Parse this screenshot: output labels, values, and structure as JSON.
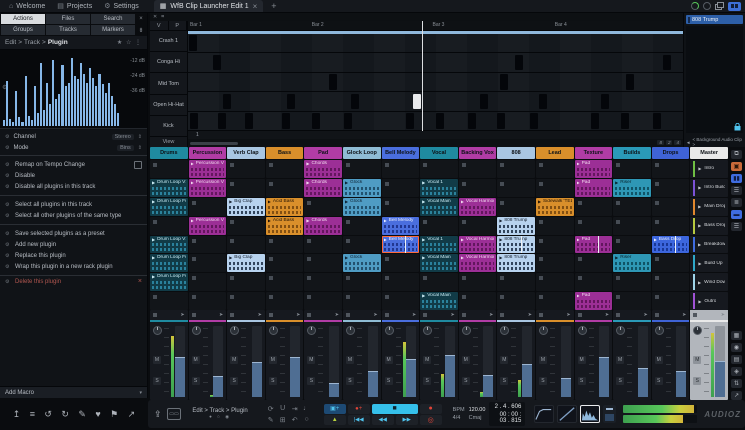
{
  "top_bar": {
    "menu": [
      {
        "name": "welcome",
        "icon_name": "home-icon",
        "icon": "⌂",
        "label": "Welcome"
      },
      {
        "name": "projects",
        "icon_name": "folder-icon",
        "icon": "▤",
        "label": "Projects"
      },
      {
        "name": "settings",
        "icon_name": "gear-icon",
        "icon": "⚙",
        "label": "Settings"
      }
    ],
    "tab": {
      "icon": "▦",
      "title": "WfB Clip Launcher Edit 1",
      "close": "×"
    },
    "new_tab": "+"
  },
  "left_panel": {
    "tabs": [
      {
        "label": "Actions",
        "active": true
      },
      {
        "label": "Files",
        "active": false
      },
      {
        "label": "Search",
        "active": false
      },
      {
        "label": "Groups",
        "active": false
      },
      {
        "label": "Tracks",
        "active": false
      },
      {
        "label": "Markers",
        "active": false
      }
    ],
    "tab_side_icons": [
      {
        "name": "close-panel-icon",
        "glyph": "×"
      },
      {
        "name": "pin-panel-icon",
        "glyph": "⇟"
      }
    ],
    "breadcrumb": {
      "parts": [
        "Edit",
        "Track",
        "Plugin"
      ],
      "sep": ">",
      "stars": "★ ☆ ⋮"
    },
    "spectrum": {
      "db_labels": [
        "-12 dB",
        "-24 dB",
        "-36 dB"
      ],
      "bars": [
        8,
        62,
        10,
        6,
        48,
        12,
        5,
        70,
        14,
        8,
        55,
        18,
        88,
        22,
        60,
        30,
        92,
        38,
        45,
        85,
        55,
        60,
        95,
        70,
        65,
        88,
        72,
        60,
        80,
        66,
        55,
        72,
        58,
        46,
        60,
        42,
        30,
        18
      ]
    },
    "properties": [
      {
        "label": "Channel",
        "value": "Stereo"
      },
      {
        "label": "Mode",
        "value": "Bins"
      }
    ],
    "action_groups": [
      [
        {
          "label": "Remap on Tempo Change",
          "checkbox": true
        },
        {
          "label": "Disable"
        },
        {
          "label": "Disable all plugins in this track"
        }
      ],
      [
        {
          "label": "Select all plugins in this track"
        },
        {
          "label": "Select all other plugins of the same type"
        }
      ],
      [
        {
          "label": "Save selected plugins as a preset"
        },
        {
          "label": "Add new plugin"
        },
        {
          "label": "Replace this plugin"
        },
        {
          "label": "Wrap this plugin in a new rack plugin"
        }
      ]
    ],
    "delete_action": "Delete this plugin",
    "add_macro": "Add Macro",
    "toolbar_icons": [
      {
        "name": "import-icon",
        "glyph": "↥"
      },
      {
        "name": "menu-icon",
        "glyph": "≡"
      },
      {
        "name": "undo-icon",
        "glyph": "↺"
      },
      {
        "name": "redo-icon",
        "glyph": "↻"
      },
      {
        "name": "tools-icon",
        "glyph": "✎"
      },
      {
        "name": "favorites-icon",
        "glyph": "♥"
      },
      {
        "name": "flag-icon",
        "glyph": "⚑"
      },
      {
        "name": "export-icon",
        "glyph": "↗"
      }
    ]
  },
  "editor": {
    "top_icons": [
      {
        "name": "close-editor-icon",
        "glyph": "✕"
      },
      {
        "name": "grid-mode-icon",
        "glyph": "⌗"
      }
    ],
    "columns": [
      "V",
      "P"
    ],
    "rows": [
      {
        "label": "Crash 1",
        "notes": [
          0.002
        ]
      },
      {
        "label": "Conga Hi",
        "notes": [
          0.05,
          0.66,
          0.96
        ]
      },
      {
        "label": "Mid Tom",
        "notes": [
          0.285,
          0.63,
          0.885
        ]
      },
      {
        "label": "Open Hi-Hat",
        "notes": [
          0.07,
          0.2,
          0.33,
          0.455,
          0.59,
          0.71,
          0.835
        ],
        "white_note": 0.455
      },
      {
        "label": "Kick",
        "notes": [
          0.004,
          0.06,
          0.115,
          0.19,
          0.25,
          0.315,
          0.44,
          0.5,
          0.565,
          0.625,
          0.69,
          0.815,
          0.875,
          0.94
        ]
      }
    ],
    "view_label": "View",
    "footer_number": "1",
    "bars": [
      {
        "label": "Bar 1",
        "pos": 0.004
      },
      {
        "label": "Bar 2",
        "pos": 0.25
      },
      {
        "label": "Bar 3",
        "pos": 0.494
      },
      {
        "label": "Bar 4",
        "pos": 0.741
      }
    ],
    "playhead": 0.472,
    "pattern_controls": [
      "8",
      "2",
      "4"
    ]
  },
  "right_panel": {
    "clip_name": "808 Trump",
    "footer_arrow": "◄",
    "footer": "< Background Audio Clip >"
  },
  "grid": {
    "tracks": [
      {
        "name": "Drums",
        "color": "#1f8aa0"
      },
      {
        "name": "Percussion",
        "color": "#b13ca5"
      },
      {
        "name": "Verb Clap",
        "color": "#a9c6e2"
      },
      {
        "name": "Bass",
        "color": "#d98f2b"
      },
      {
        "name": "Pad",
        "color": "#b13ca5"
      },
      {
        "name": "Glock Loop",
        "color": "#8fbcd4"
      },
      {
        "name": "Bell Melody",
        "color": "#4a6ede"
      },
      {
        "name": "Vocal",
        "color": "#1f8aa0"
      },
      {
        "name": "Backing Vox",
        "color": "#b13ca5"
      },
      {
        "name": "808",
        "color": "#a9c6e2"
      },
      {
        "name": "Lead",
        "color": "#d98f2b"
      },
      {
        "name": "Texture",
        "color": "#b13ca5"
      },
      {
        "name": "Builds",
        "color": "#2a9ab8"
      },
      {
        "name": "Drops",
        "color": "#3f63d6"
      },
      {
        "name": "Master",
        "color": "#e9e9e9"
      }
    ],
    "clip_styles": {
      "teal": {
        "bg": "#113b47",
        "fg": "#cdeef7",
        "wave": "#2e8aa6"
      },
      "magenta": {
        "bg": "#9c2f96",
        "fg": "#f2d9ef",
        "wave": "#5e1458"
      },
      "lightblue": {
        "bg": "#b7d2ee",
        "fg": "#16202e",
        "wave": "#24364e"
      },
      "orange": {
        "bg": "#d98f2b",
        "fg": "#241506",
        "wave": "#7a4a10"
      },
      "glock": {
        "bg": "#4f9cc4",
        "fg": "#0e2233",
        "wave": "#1d4a66"
      },
      "blue": {
        "bg": "#4a6ede",
        "fg": "#e8edff",
        "wave": "#1d3189"
      },
      "tealbright": {
        "bg": "#2e97b5",
        "fg": "#08222a",
        "wave": "#0d4c5e"
      },
      "dropblue": {
        "bg": "#3c66dd",
        "fg": "#e8edff",
        "wave": "#16328f"
      }
    },
    "scenes": [
      [
        {
          "t": 1,
          "label": "Percussion V1",
          "style": "magenta"
        },
        {
          "t": 4,
          "label": "Chords",
          "style": "magenta"
        },
        {
          "t": 11,
          "label": "Pad",
          "style": "magenta"
        },
        {
          "t": 14,
          "label": "Intro",
          "stripe": "#6fbf44"
        }
      ],
      [
        {
          "t": 0,
          "label": "Drum Loop V1",
          "style": "teal"
        },
        {
          "t": 1,
          "label": "Percussion V1",
          "style": "magenta"
        },
        {
          "t": 4,
          "label": "Chords",
          "style": "magenta"
        },
        {
          "t": 5,
          "label": "Glock",
          "style": "glock"
        },
        {
          "t": 7,
          "label": "Vocal 1",
          "style": "teal"
        },
        {
          "t": 11,
          "label": "Pad",
          "style": "magenta"
        },
        {
          "t": 12,
          "label": "Riser",
          "style": "tealbright"
        },
        {
          "t": 14,
          "label": "Intro Build",
          "stripe": "#7b52d6"
        }
      ],
      [
        {
          "t": 0,
          "label": "Drum Loop Full",
          "style": "teal"
        },
        {
          "t": 2,
          "label": "Big Clap",
          "style": "lightblue"
        },
        {
          "t": 3,
          "label": "Acid Bass",
          "style": "orange"
        },
        {
          "t": 5,
          "label": "Glock",
          "style": "glock"
        },
        {
          "t": 7,
          "label": "Vocal Main",
          "style": "teal"
        },
        {
          "t": 8,
          "label": "Vocal Harmony",
          "style": "magenta"
        },
        {
          "t": 10,
          "label": "Sidewalk 'TELO...",
          "style": "orange"
        },
        {
          "t": 14,
          "label": "Main Drop",
          "stripe": "#e0872e"
        }
      ],
      [
        {
          "t": 1,
          "label": "Percussion V1",
          "style": "magenta"
        },
        {
          "t": 3,
          "label": "Acid Bass",
          "style": "orange"
        },
        {
          "t": 4,
          "label": "Chords",
          "style": "magenta"
        },
        {
          "t": 6,
          "label": "Bell Melody",
          "style": "blue"
        },
        {
          "t": 9,
          "label": "808 Trump",
          "style": "lightblue"
        },
        {
          "t": 14,
          "label": "Bass Drop",
          "stripe": "#b7c93f"
        }
      ],
      [
        {
          "t": 0,
          "label": "Drum Loop V1",
          "style": "teal"
        },
        {
          "t": 6,
          "label": "Bell Melody",
          "style": "blue",
          "selected": true,
          "playing": true
        },
        {
          "t": 7,
          "label": "Vocal 1",
          "style": "teal"
        },
        {
          "t": 8,
          "label": "Vocal Harmony",
          "style": "magenta"
        },
        {
          "t": 9,
          "label": "808 Trump",
          "style": "lightblue",
          "playing": true
        },
        {
          "t": 11,
          "label": "Pad",
          "style": "magenta",
          "playing": true
        },
        {
          "t": 13,
          "label": "Bass Drop",
          "style": "dropblue",
          "playing": true
        },
        {
          "t": 14,
          "label": "Breakdown",
          "stripe": "#3f6ce0"
        }
      ],
      [
        {
          "t": 0,
          "label": "Drum Loop Full",
          "style": "teal"
        },
        {
          "t": 2,
          "label": "Big Clap",
          "style": "lightblue"
        },
        {
          "t": 5,
          "label": "Glock",
          "style": "glock"
        },
        {
          "t": 7,
          "label": "Vocal Main",
          "style": "teal"
        },
        {
          "t": 8,
          "label": "Vocal Harmony",
          "style": "magenta"
        },
        {
          "t": 9,
          "label": "808 Trump",
          "style": "lightblue"
        },
        {
          "t": 12,
          "label": "Riser",
          "style": "tealbright"
        },
        {
          "t": 14,
          "label": "Build Up",
          "stripe": "#2fa8c9"
        }
      ],
      [
        {
          "t": 0,
          "label": "Drum Loop Full",
          "style": "teal"
        },
        {
          "t": 14,
          "label": "Wind Down",
          "stripe": "#9fd4ea"
        }
      ],
      [
        {
          "t": 7,
          "label": "Vocal Main",
          "style": "teal"
        },
        {
          "t": 11,
          "label": "Pad",
          "style": "magenta"
        },
        {
          "t": 14,
          "label": "Outro",
          "stripe": "#a052d6"
        }
      ]
    ]
  },
  "right_rail": {
    "top_icons": [
      {
        "name": "float-window-icon",
        "glyph": "⧉",
        "bg": "#23272e",
        "fg": "#aeb3ba"
      },
      {
        "name": "clip-properties-icon",
        "glyph": "▣",
        "bg": "#c96a3a",
        "fg": "#2a1608"
      },
      {
        "name": "mixer-toggle-icon",
        "glyph": "▮▮",
        "bg": "#3f6ce0",
        "fg": "#0f1b42"
      },
      {
        "name": "tracks-toggle-icon",
        "glyph": "☰",
        "bg": "#23272e",
        "fg": "#aeb3ba"
      },
      {
        "name": "lanes-toggle-icon",
        "glyph": "≣",
        "bg": "#23272e",
        "fg": "#aeb3ba"
      },
      {
        "name": "scenes-toggle-icon",
        "glyph": "▬",
        "bg": "#3f6ce0",
        "fg": "#0f1b42"
      },
      {
        "name": "list-toggle-icon",
        "glyph": "☰",
        "bg": "#23272e",
        "fg": "#aeb3ba"
      }
    ],
    "bottom_icons": [
      {
        "name": "grid-view-icon",
        "glyph": "▦",
        "bg": "#23272e",
        "fg": "#aeb3ba"
      },
      {
        "name": "target-icon",
        "glyph": "◉",
        "bg": "#23272e",
        "fg": "#aeb3ba"
      },
      {
        "name": "browser-icon",
        "glyph": "▤",
        "bg": "#23272e",
        "fg": "#aeb3ba"
      },
      {
        "name": "monitor-icon",
        "glyph": "◈",
        "bg": "#23272e",
        "fg": "#aeb3ba"
      },
      {
        "name": "routing-icon",
        "glyph": "⇅",
        "bg": "#23272e",
        "fg": "#aeb3ba"
      },
      {
        "name": "share-icon",
        "glyph": "↗",
        "bg": "#23272e",
        "fg": "#aeb3ba"
      }
    ]
  },
  "mixer": {
    "labels": {
      "mute": "M",
      "solo": "S"
    },
    "strips": [
      {
        "fader": 55,
        "meter": 78
      },
      {
        "fader": 28,
        "meter": 2
      },
      {
        "fader": 48,
        "meter": 0
      },
      {
        "fader": 55,
        "meter": 0
      },
      {
        "fader": 18,
        "meter": 0
      },
      {
        "fader": 35,
        "meter": 0
      },
      {
        "fader": 52,
        "meter": 70
      },
      {
        "fader": 58,
        "meter": 30
      },
      {
        "fader": 30,
        "meter": 6
      },
      {
        "fader": 45,
        "meter": 22
      },
      {
        "fader": 25,
        "meter": 0
      },
      {
        "fader": 55,
        "meter": 0
      },
      {
        "fader": 40,
        "meter": 0
      },
      {
        "fader": 35,
        "meter": 0
      },
      {
        "fader": 50,
        "meter": 82,
        "master": true
      }
    ]
  },
  "transport": {
    "left_icons": [
      {
        "name": "export-edit-icon",
        "glyph": "⇪"
      },
      {
        "name": "tape-icon",
        "glyph": "▭▭"
      }
    ],
    "breadcrumb": "Edit > Track > Plugin",
    "page_dots": "● ○ ◉",
    "icon_row1": [
      {
        "name": "loop-icon",
        "glyph": "⟳"
      },
      {
        "name": "snap-icon",
        "glyph": "U"
      },
      {
        "name": "punch-icon",
        "glyph": "⇥"
      },
      {
        "name": "metronome-icon",
        "glyph": "♩"
      }
    ],
    "icon_row2": [
      {
        "name": "pencil-icon",
        "glyph": "✎"
      },
      {
        "name": "lock-icon",
        "glyph": "⊞"
      },
      {
        "name": "revert-icon",
        "glyph": "↶"
      },
      {
        "name": "midi-monitor-icon",
        "glyph": "○"
      }
    ],
    "buttons": {
      "add_clip": "▣+",
      "record_add": "●+",
      "stop": "■",
      "record": "●",
      "warning": "▲",
      "to_start": "|◀◀",
      "rewind": "◀◀",
      "forward": "▶▶",
      "loop_record": "◎"
    },
    "bpm_label": "BPM",
    "bpm": "120.00",
    "sig": "4/4",
    "key": "Cmaj",
    "position": "2 . 4 . 606",
    "time": "00 : 00 : 03 . 815",
    "out_meters": [
      95,
      80
    ],
    "watermark": "AUDIOZ"
  }
}
